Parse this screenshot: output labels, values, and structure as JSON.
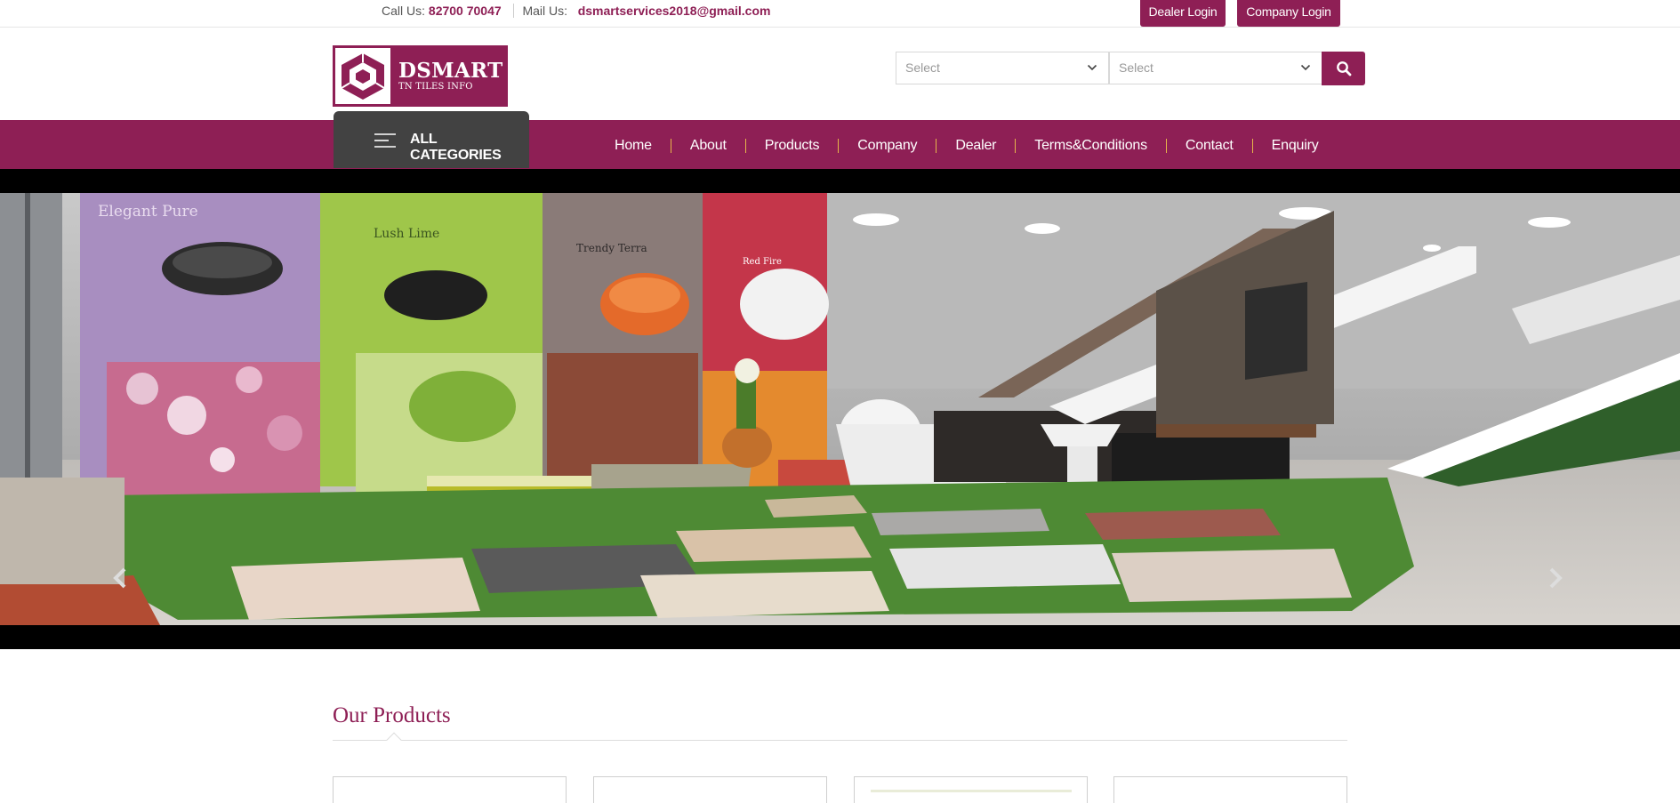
{
  "topbar": {
    "call_label": "Call Us:",
    "call_value": "82700 70047",
    "mail_label": "Mail Us:",
    "mail_value": "dsmartservices2018@gmail.com",
    "dealer_login": "Dealer Login",
    "company_login": "Company Login"
  },
  "logo": {
    "title": "DSMART",
    "subtitle": "TN TILES INFO",
    "icon": "hexagon-logo-icon"
  },
  "search": {
    "select1": "Select",
    "select2": "Select",
    "button_icon": "search-icon"
  },
  "nav": {
    "all_categories": "ALL CATEGORIES",
    "items": [
      "Home",
      "About",
      "Products",
      "Company",
      "Dealer",
      "Terms&Conditions",
      "Contact",
      "Enquiry"
    ]
  },
  "banner": {
    "prev_icon": "chevron-left-icon",
    "next_icon": "chevron-right-icon",
    "photo_labels": [
      "Elegant Pure",
      "Lush Lime",
      "Trendy Terra",
      "Red Fire"
    ]
  },
  "products": {
    "title": "Our Products"
  },
  "colors": {
    "brand": "#8e1f55",
    "category_bg": "#424242",
    "divider_accent": "#e6b54a"
  }
}
